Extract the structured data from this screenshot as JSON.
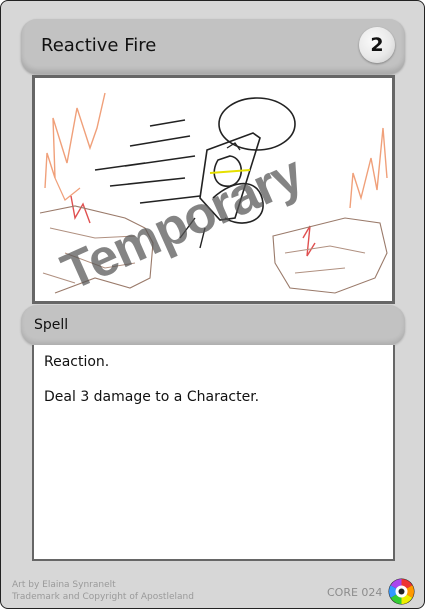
{
  "card": {
    "title": "Reactive Fire",
    "cost": "2",
    "watermark": "Temporary",
    "type": "Spell",
    "rules": [
      "Reaction.",
      "Deal 3 damage to a Character."
    ],
    "footer": {
      "artist": "Art by Elaina Synranelt",
      "trademark": "Trademark and Copyright of Apostleland",
      "set_code": "CORE 024"
    }
  },
  "colors": {
    "card_bg": "#d7d7d7",
    "bar": "#c2c2c2",
    "watermark": "#555555"
  }
}
